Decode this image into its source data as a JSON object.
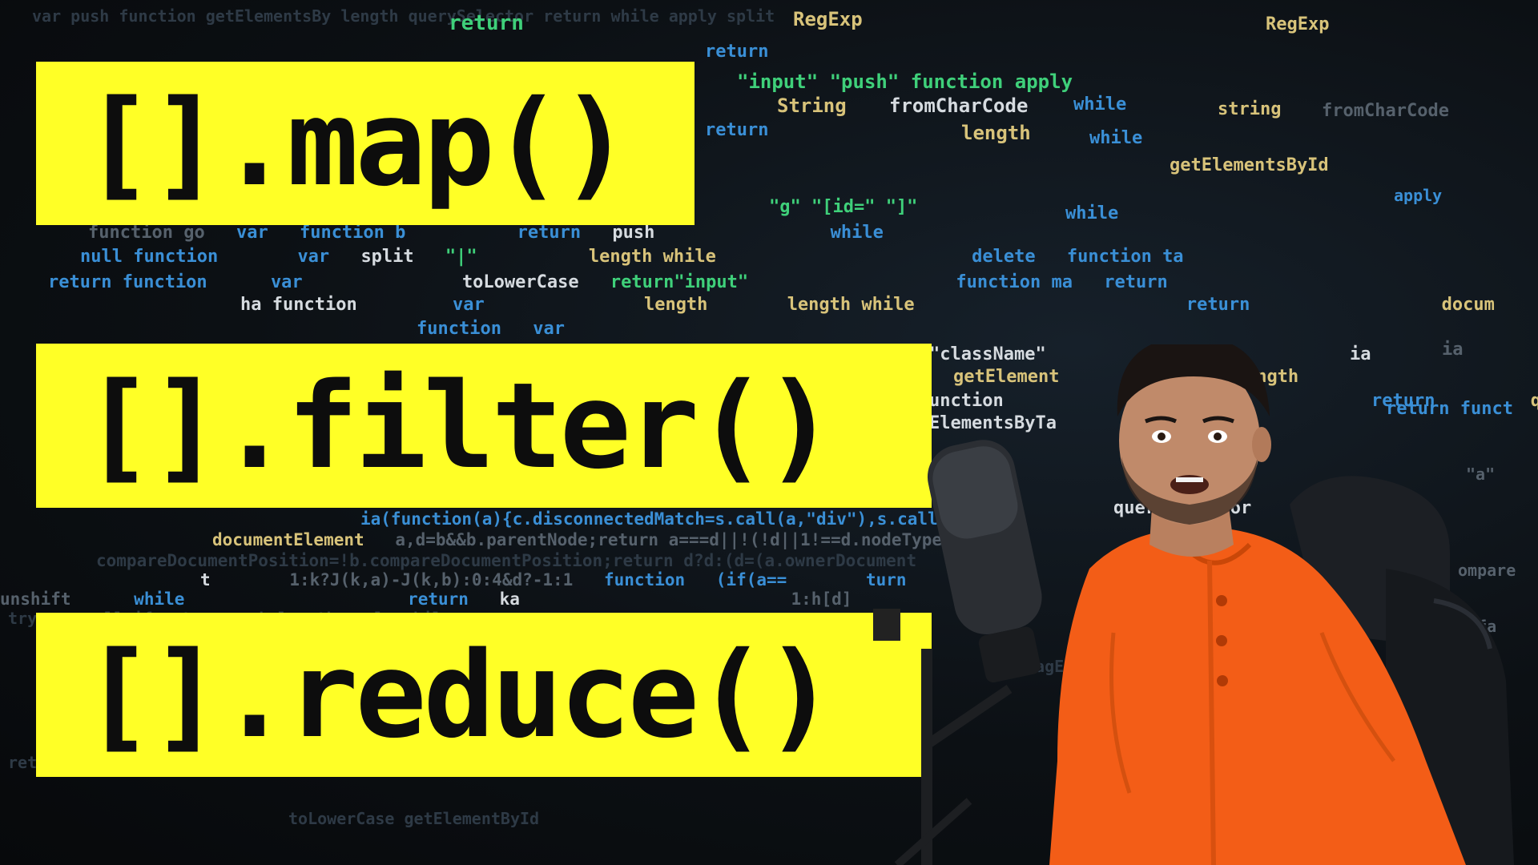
{
  "labels": {
    "map": "[].map()",
    "filter": "[].filter()",
    "reduce": "[].reduce()"
  },
  "code_lines": [
    [
      "function go",
      "var",
      "function b",
      "return",
      "push",
      "while"
    ],
    [
      "null function",
      "var",
      "split",
      "\"|\"",
      "length while",
      "delete",
      "function ta"
    ],
    [
      "return function",
      "var",
      "toLowerCase",
      "return\"input\"",
      "function ma",
      "return"
    ],
    [
      "ha function",
      "var",
      "length",
      "length while",
      "return",
      "docum"
    ],
    [
      "function",
      "var",
      "\"className\"",
      "ia"
    ],
    [
      "getElement",
      "length"
    ],
    [
      "unction",
      "return",
      "querySelectorAll"
    ],
    [
      "ElementsByTa",
      "querySelector"
    ],
    [
      "ia(function(a){c.disconnectedMatch=s.call(a,\"div\"),s.call"
    ],
    [
      "documentElement",
      "a,d=b&&b.parentNode;return a===d||!(!d||1!==d.nodeType"
    ],
    [
      "compareDocumentPosition=!b.compareDocumentPosition;return d?d:(d=(a.ownerDocument"
    ],
    [
      "t",
      "1:k?J(k,a)-J(k,b):0:4&d?-1:1",
      "function",
      "(if(a==",
      "turn"
    ],
    [
      "unshift",
      "while",
      "return",
      "ka",
      "1:h[d]"
    ]
  ],
  "colors": {
    "label_bg": "#ffff26",
    "label_text": "#0d0d0d",
    "shirt": "#f35d17",
    "background": "#0b0d10"
  }
}
